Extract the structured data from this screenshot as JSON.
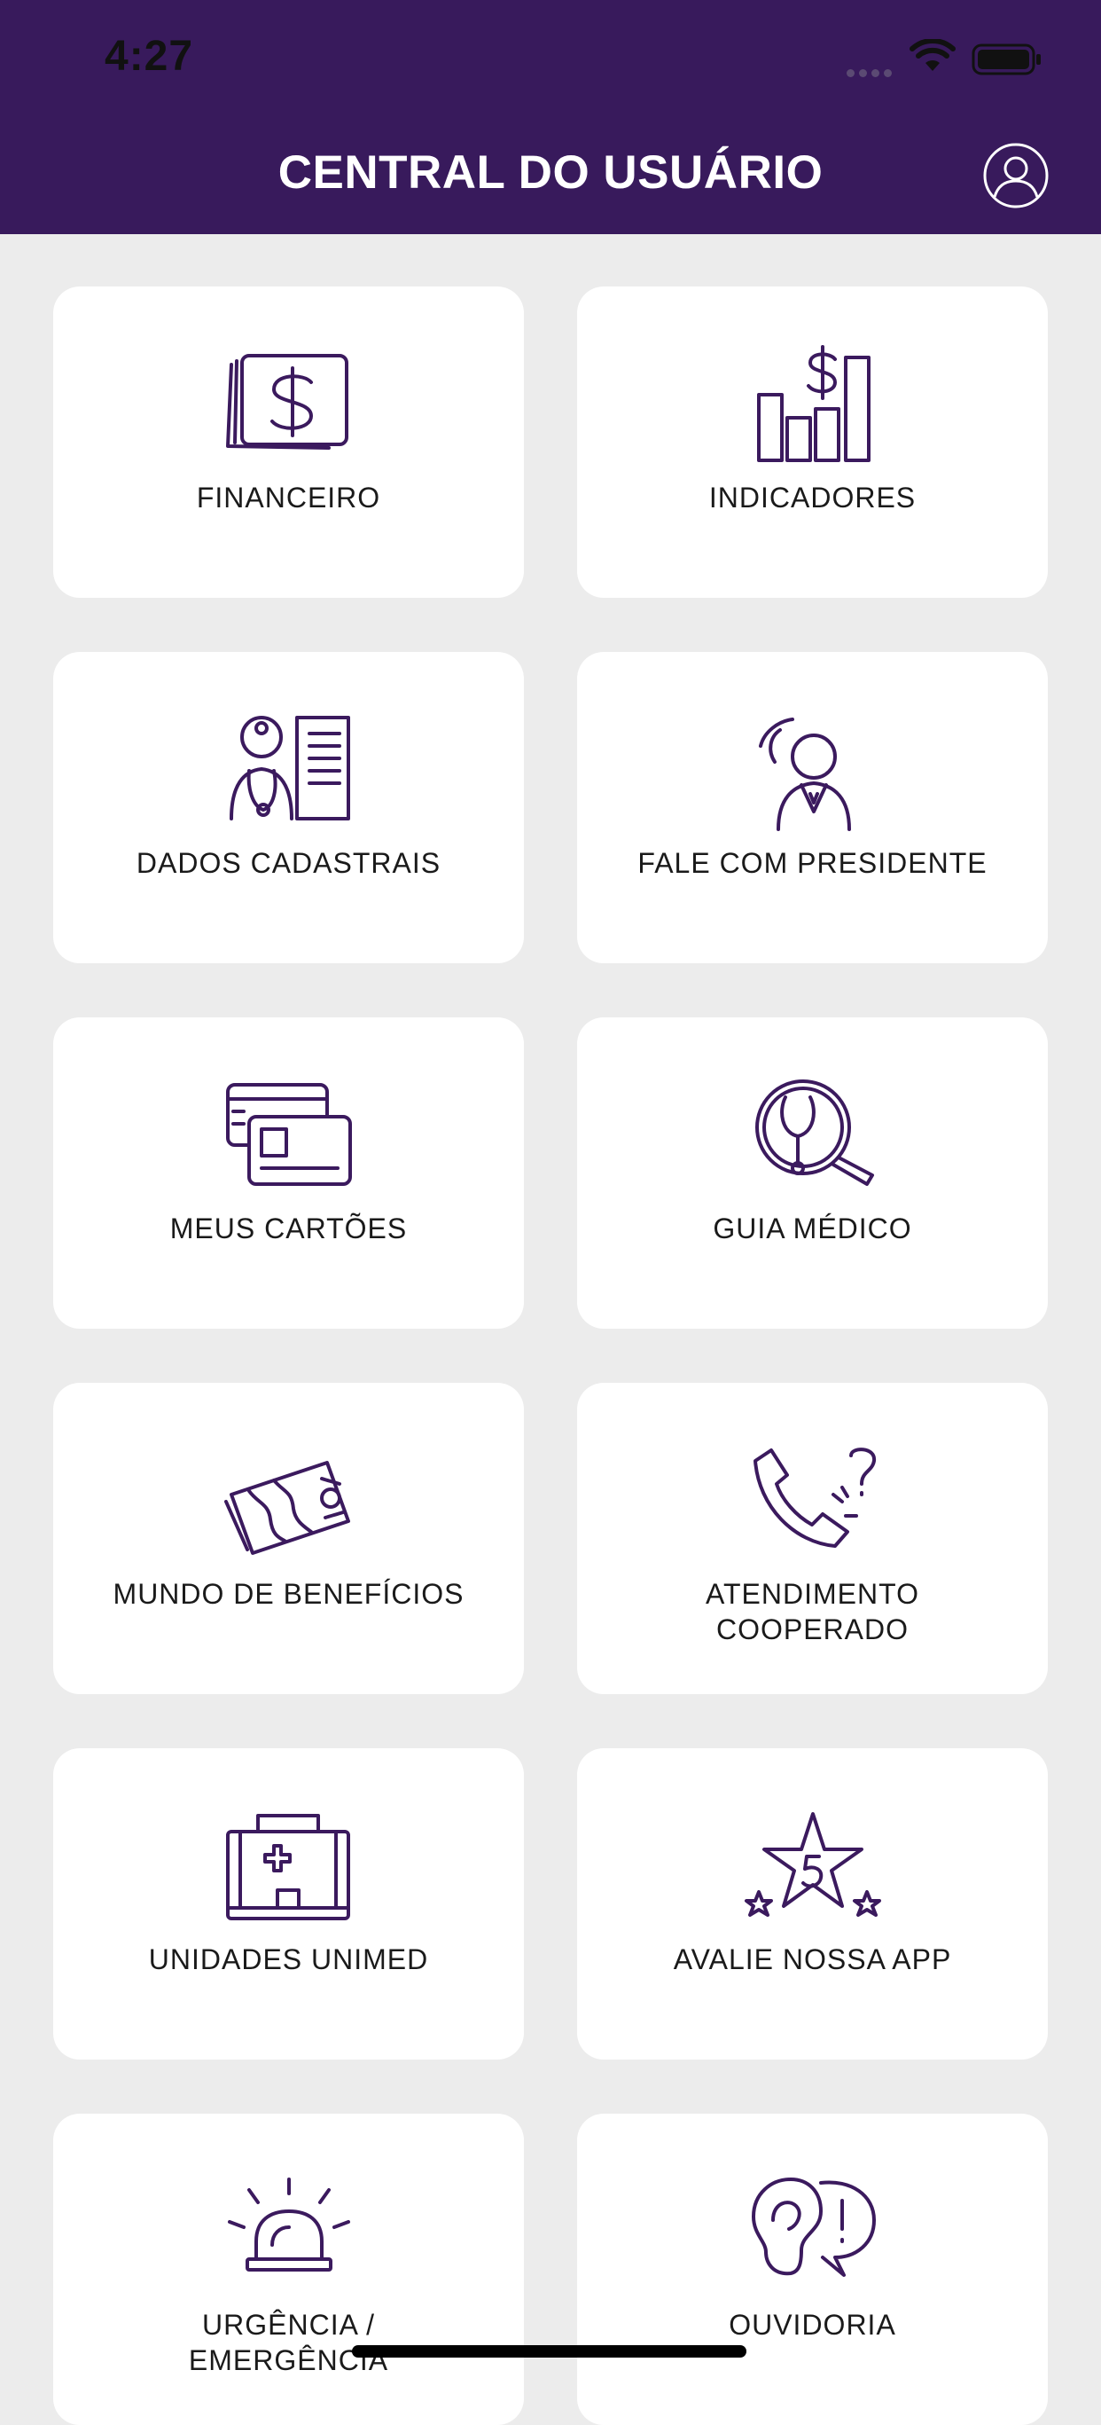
{
  "status_bar": {
    "time": "4:27"
  },
  "header": {
    "title": "CENTRAL DO USUÁRIO",
    "profile_icon": "user-circle-icon"
  },
  "menu": {
    "items": [
      {
        "label": "FINANCEIRO",
        "icon": "money-icon"
      },
      {
        "label": "INDICADORES",
        "icon": "bar-chart-dollar-icon"
      },
      {
        "label": "DADOS CADASTRAIS",
        "icon": "doctor-profile-icon"
      },
      {
        "label": "FALE COM PRESIDENTE",
        "icon": "president-speaking-icon"
      },
      {
        "label": "MEUS CARTÕES",
        "icon": "cards-icon"
      },
      {
        "label": "GUIA MÉDICO",
        "icon": "stethoscope-search-icon"
      },
      {
        "label": "MUNDO DE BENEFÍCIOS",
        "icon": "benefits-map-icon"
      },
      {
        "label": "ATENDIMENTO\nCOOPERADO",
        "icon": "phone-question-icon"
      },
      {
        "label": "UNIDADES UNIMED",
        "icon": "hospital-icon"
      },
      {
        "label": "AVALIE NOSSA APP",
        "icon": "five-star-rating-icon"
      },
      {
        "label": "URGÊNCIA /\nEMERGÊNCIA",
        "icon": "siren-icon"
      },
      {
        "label": "OUVIDORIA",
        "icon": "ear-exclamation-icon"
      }
    ]
  },
  "colors": {
    "header_bg": "#381a5c",
    "page_bg": "#ececec",
    "card_bg": "#ffffff",
    "icon_stroke": "#3b1a5e"
  }
}
